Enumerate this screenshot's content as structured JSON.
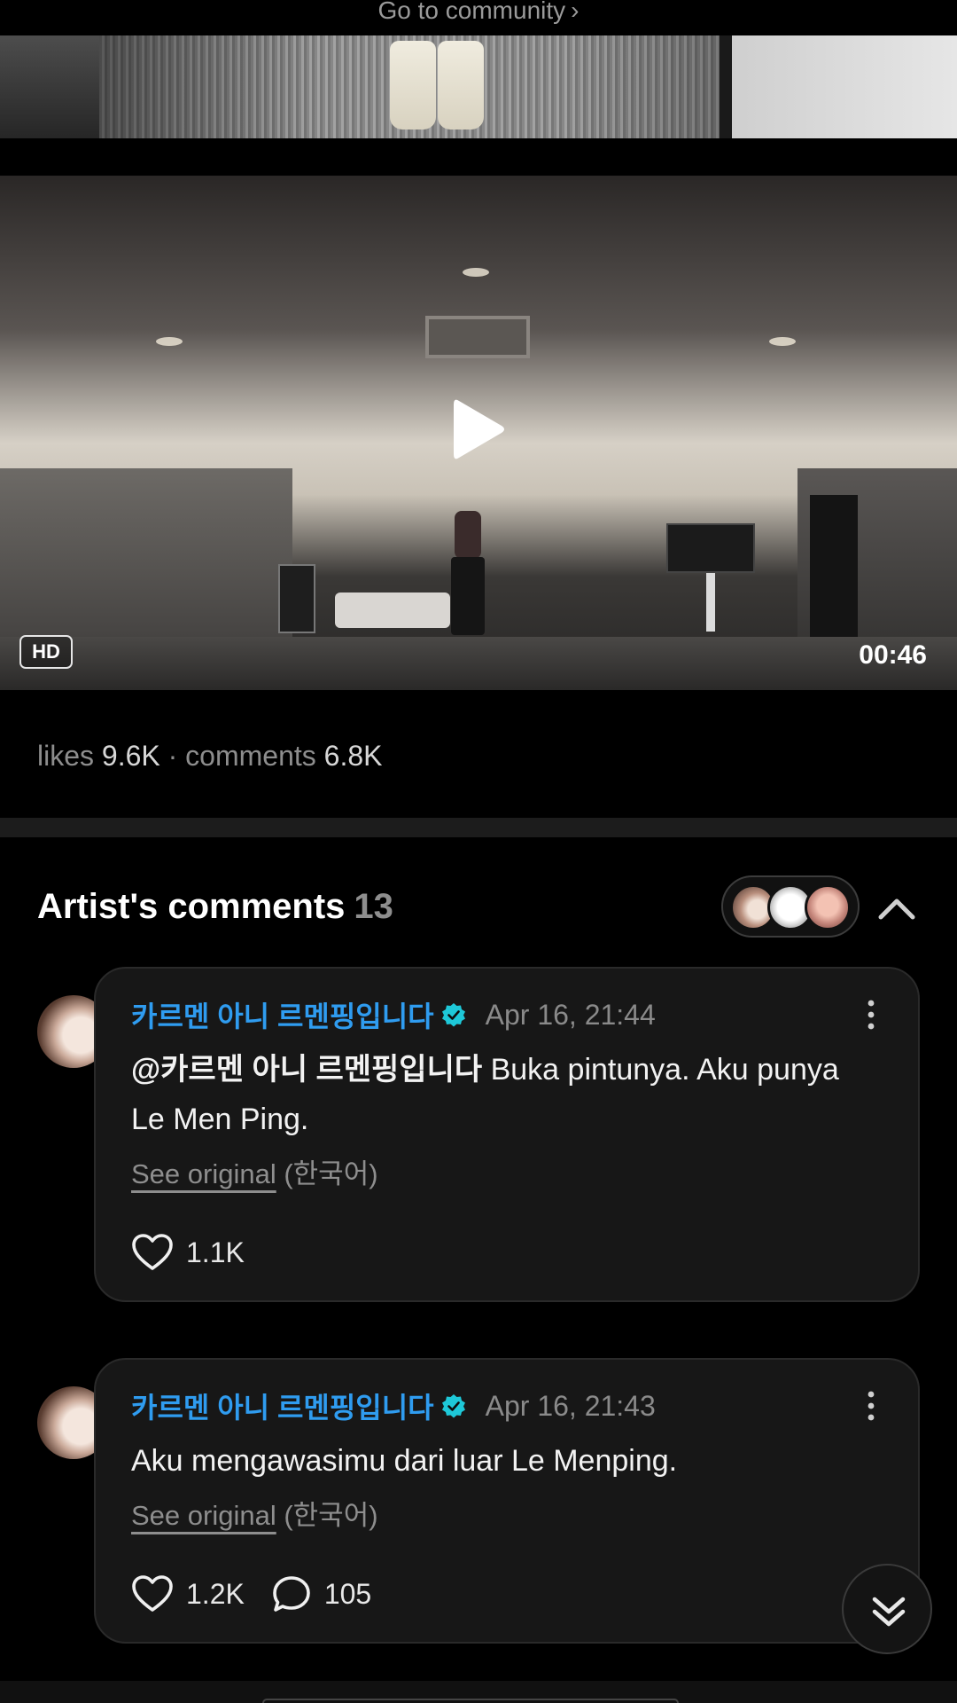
{
  "community_link": {
    "label": "Go to community",
    "chevron": "›"
  },
  "video": {
    "badge": "HD",
    "duration": "00:46",
    "play_icon": "play-icon"
  },
  "stats": {
    "likes_label": "likes",
    "likes_value": "9.6K",
    "separator": "·",
    "comments_label": "comments",
    "comments_value": "6.8K"
  },
  "artist_comments": {
    "title": "Artist's comments",
    "count": "13",
    "collapse_icon": "chevron-up-icon"
  },
  "comments": [
    {
      "author": "카르멘 아니 르멘핑입니다",
      "date": "Apr 16, 21:44",
      "mention": "@카르멘 아니 르멘핑입니다",
      "text": " Buka pintunya. Aku punya Le Men Ping.",
      "see_original": "See original",
      "language": "(한국어)",
      "likes": "1.1K"
    },
    {
      "author": "카르멘 아니 르멘핑입니다",
      "date": "Apr 16, 21:43",
      "text": "Aku mengawasimu dari luar Le Menping.",
      "see_original": "See original",
      "language": "(한국어)",
      "likes": "1.2K",
      "replies": "105"
    }
  ],
  "colors": {
    "accent_name": "#2f9cf0",
    "verified": "#1ec8d8",
    "background": "#000000",
    "card": "#171717"
  }
}
